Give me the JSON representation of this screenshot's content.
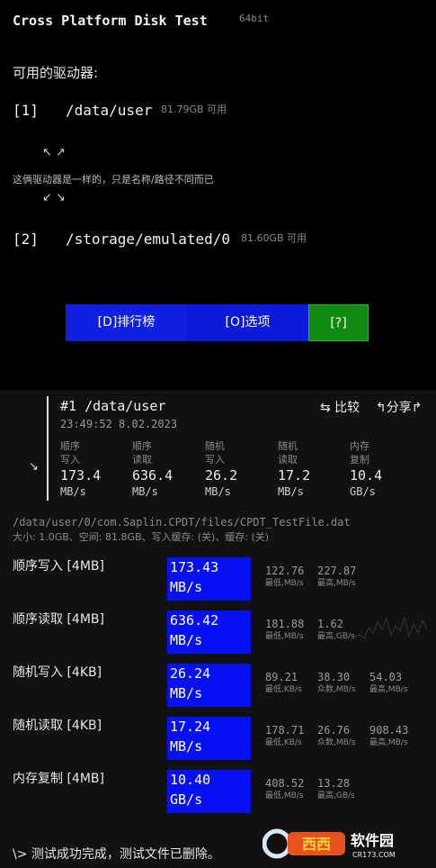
{
  "app": {
    "title": "Cross Platform Disk Test",
    "bits": "64bit"
  },
  "drives_label": "可用的驱动器:",
  "drives": [
    {
      "index": "[1]",
      "path": "/data/user",
      "free": "81.79GB 可用"
    },
    {
      "index": "[2]",
      "path": "/storage/emulated/0",
      "free": "81.60GB 可用"
    }
  ],
  "same_note": "这俩驱动器是一样的，只是名称/路径不同而已",
  "arrows": {
    "up": "↖ ↗",
    "down": "↙ ↘"
  },
  "buttons": {
    "rank": "[D]排行榜",
    "options": "[O]选项",
    "help": "[?]"
  },
  "result": {
    "title": "#1 /data/user",
    "time": "23:49:52 8.02.2023",
    "compare": "⇆ 比较",
    "share": "↰分享↱",
    "collapse": "↘",
    "stats": [
      {
        "l1": "顺序",
        "l2": "写入",
        "value": "173.4",
        "unit": "MB/s"
      },
      {
        "l1": "顺序",
        "l2": "读取",
        "value": "636.4",
        "unit": "MB/s"
      },
      {
        "l1": "随机",
        "l2": "写入",
        "value": "26.2",
        "unit": "MB/s"
      },
      {
        "l1": "随机",
        "l2": "读取",
        "value": "17.2",
        "unit": "MB/s"
      },
      {
        "l1": "内存",
        "l2": "复制",
        "value": "10.4",
        "unit": "GB/s"
      }
    ]
  },
  "file": {
    "path": "/data/user/0/com.Saplin.CPDT/files/CPDT_TestFile.dat",
    "info": "大小: 1.0GB、空间: 81.8GB、写入缓存: (关)、缓存: (关)"
  },
  "tests": [
    {
      "name": "顺序写入 [4MB]",
      "value": "173.43",
      "unit": "MB/s",
      "stats": [
        {
          "v": "122.76",
          "l": "最低,MB/s"
        },
        {
          "v": "227.87",
          "l": "最高,MB/s"
        }
      ]
    },
    {
      "name": "顺序读取 [4MB]",
      "value": "636.42",
      "unit": "MB/s",
      "stats": [
        {
          "v": "181.88",
          "l": "最低,MB/s"
        },
        {
          "v": "1.62",
          "l": "最高,GB/s"
        }
      ]
    },
    {
      "name": "随机写入 [4KB]",
      "value": "26.24",
      "unit": "MB/s",
      "stats": [
        {
          "v": "89.21",
          "l": "最低,KB/s"
        },
        {
          "v": "38.30",
          "l": "众数,MB/s"
        },
        {
          "v": "54.03",
          "l": "最高,MB/s"
        }
      ]
    },
    {
      "name": "随机读取 [4KB]",
      "value": "17.24",
      "unit": "MB/s",
      "stats": [
        {
          "v": "178.71",
          "l": "最低,KB/s"
        },
        {
          "v": "26.76",
          "l": "众数,MB/s"
        },
        {
          "v": "908.43",
          "l": "最高,MB/s"
        }
      ]
    },
    {
      "name": "内存复制 [4MB]",
      "value": "10.40",
      "unit": "GB/s",
      "stats": [
        {
          "v": "408.52",
          "l": "最低,MB/s"
        },
        {
          "v": "13.28",
          "l": "最高,GB/s"
        }
      ]
    }
  ],
  "footer": "\\> 测试成功完成，测试文件已删除。",
  "watermark": {
    "brand": "软件园",
    "site": "CR173.COM",
    "mark": "西西"
  },
  "colors": {
    "bar": "#0710f0",
    "btn_blue": "#1020e0",
    "btn_green": "#128a12",
    "background": "#000000",
    "panel": "#111111"
  }
}
